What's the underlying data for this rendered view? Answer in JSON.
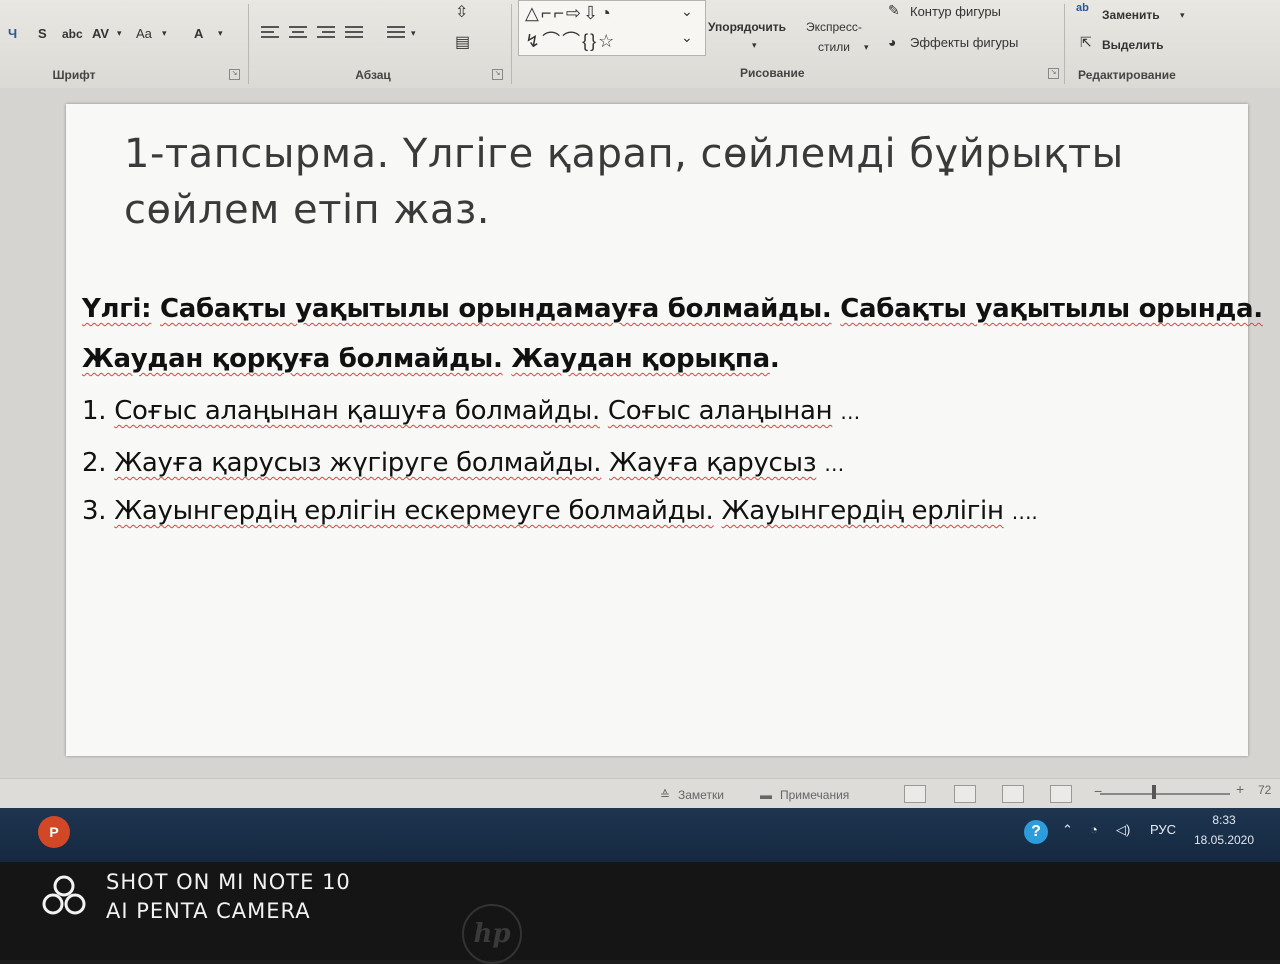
{
  "ribbon": {
    "font_group": {
      "label": "Шрифт",
      "buttons": [
        "Ч",
        "S",
        "abc",
        "AV",
        "Aa",
        "A"
      ]
    },
    "paragraph_group": {
      "label": "Абзац"
    },
    "drawing_group": {
      "label": "Рисование",
      "arrange_label": "Упорядочить",
      "express_styles_label": "Экспресс-",
      "express_styles_label2": "стили",
      "shape_outline_label": "Контур фигуры",
      "shape_effects_label": "Эффекты фигуры"
    },
    "editing_group": {
      "label": "Редактирование",
      "replace_label": "Заменить",
      "select_label": "Выделить"
    }
  },
  "slide": {
    "title_line1": "1-тапсырма. Үлгіге қарап, сөйлемді бұйрықты",
    "title_line2": "сөйлем етіп жаз.",
    "example_line1_a": "Үлгі:",
    "example_line1_b": "Сабақты уақытылы орындамауға болмайды.",
    "example_line1_c": "Сабақты уақытылы орында.",
    "example_line2_a": "Жаудан қорқуға болмайды.",
    "example_line2_b": "Жаудан қорықпа",
    "example_line2_dot": ".",
    "items": [
      {
        "num": "1.",
        "sentence": "Соғыс алаңынан қашуға болмайды.",
        "prompt": "Соғыс алаңынан",
        "dots": "…"
      },
      {
        "num": "2.",
        "sentence": "Жауға қарусыз жүгіруге болмайды.",
        "prompt": "Жауға қарусыз",
        "dots": "…"
      },
      {
        "num": "3.",
        "sentence": "Жауынгердің ерлігін ескермеуге болмайды.",
        "prompt": "Жауынгердің ерлігін",
        "dots": "…."
      }
    ]
  },
  "statusbar": {
    "notes_label": "Заметки",
    "comments_label": "Примечания",
    "zoom_minus": "−",
    "zoom_plus": "+",
    "zoom_value": "72"
  },
  "taskbar": {
    "app_icon_letter": "P",
    "help_glyph": "?",
    "language": "РУС",
    "time": "8:33",
    "date": "18.05.2020"
  },
  "photo_watermark": {
    "line1": "SHOT ON MI NOTE 10",
    "line2": "AI PENTA CAMERA"
  },
  "bezel": {
    "brand_logo_text": "hp"
  }
}
